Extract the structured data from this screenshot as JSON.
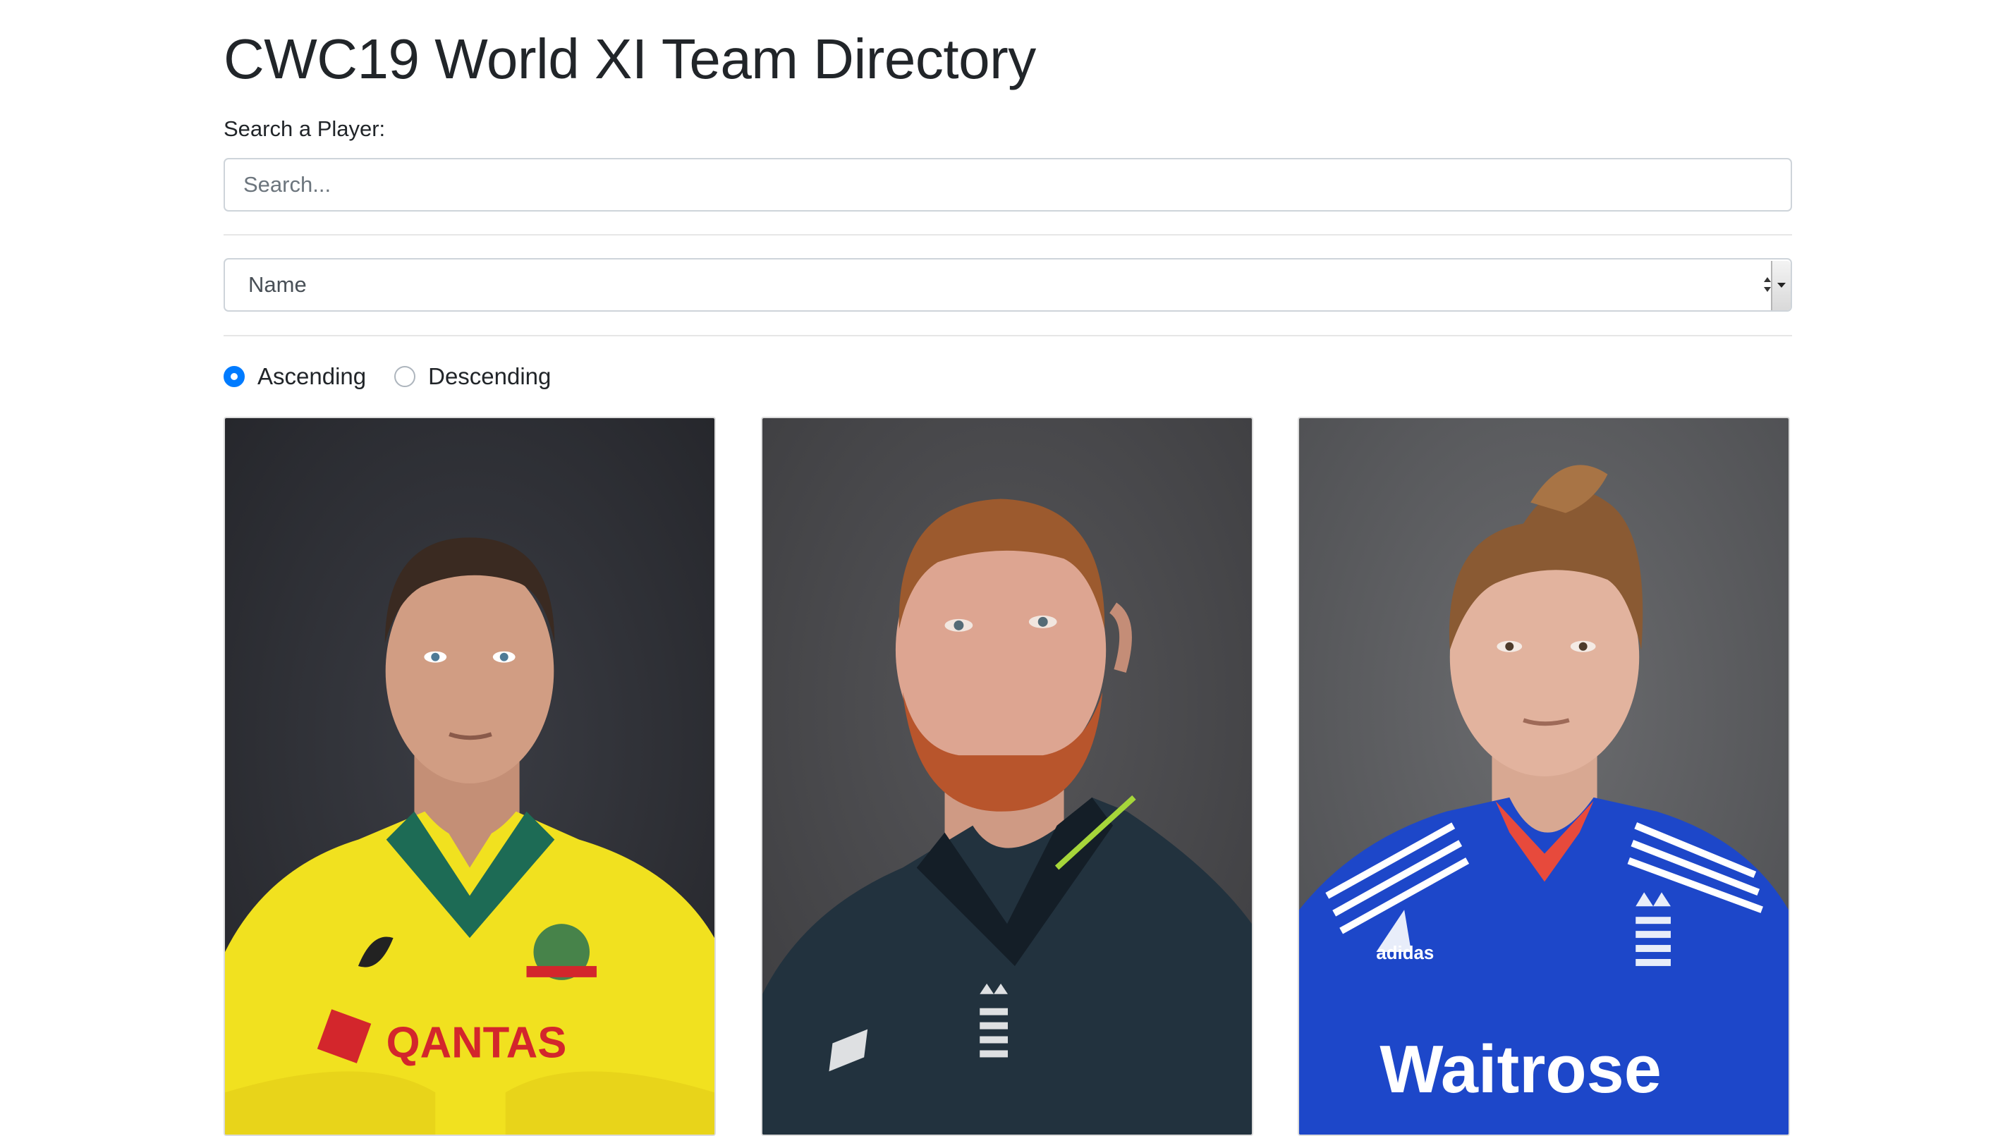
{
  "page": {
    "title": "CWC19 World XI Team Directory"
  },
  "search": {
    "label": "Search a Player:",
    "placeholder": "Search...",
    "value": ""
  },
  "sort": {
    "selected": "Name"
  },
  "order": {
    "options": [
      {
        "label": "Ascending",
        "checked": true
      },
      {
        "label": "Descending",
        "checked": false
      }
    ]
  },
  "players": [
    {
      "photo_name": "player-photo",
      "jersey_color": "#f3e21d",
      "jersey_text": "QANTAS",
      "background": "#2e3035"
    },
    {
      "photo_name": "player-photo",
      "jersey_color": "#22333f",
      "jersey_text": "",
      "background": "#4a4a4c"
    },
    {
      "photo_name": "player-photo",
      "jersey_color": "#1d47c9",
      "jersey_text": "Waitrose",
      "background": "#5a5b5e"
    }
  ],
  "colors": {
    "accent": "#007bff",
    "border": "#ced4da"
  }
}
